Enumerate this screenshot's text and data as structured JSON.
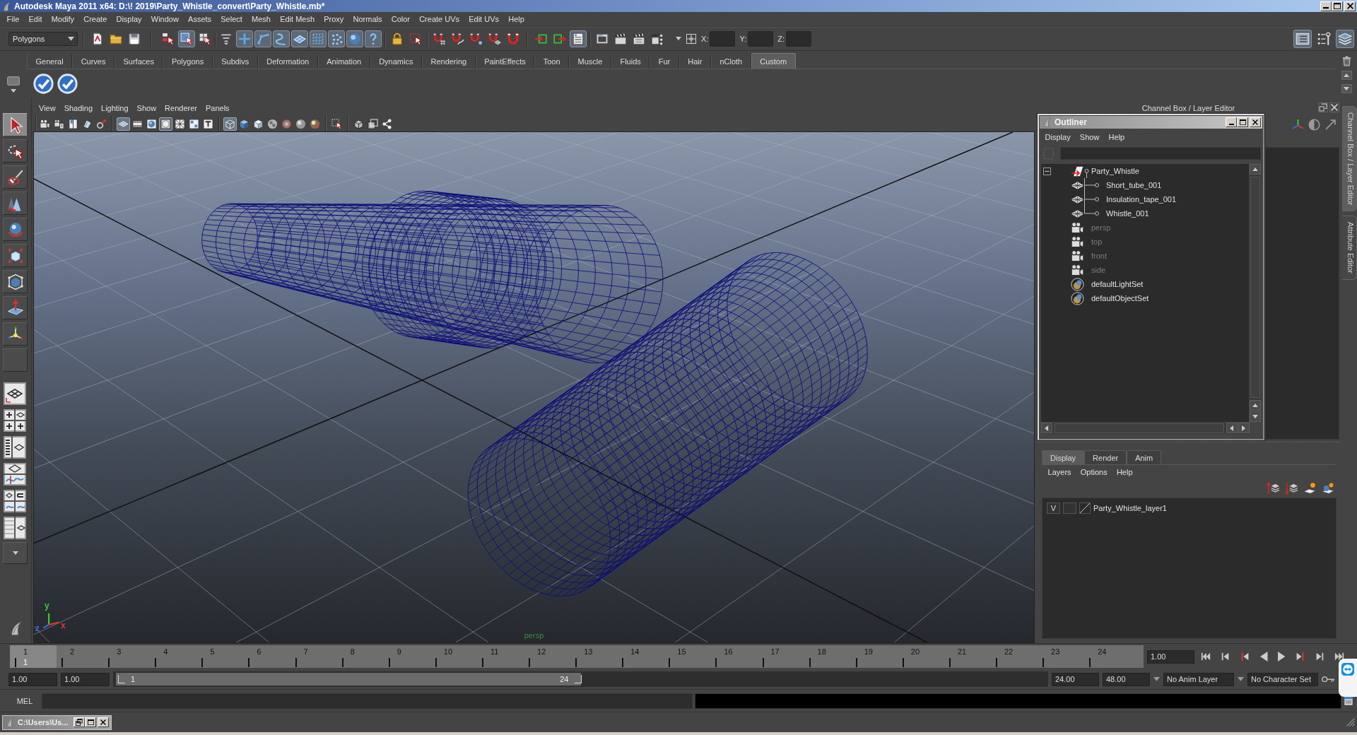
{
  "window": {
    "title": "Autodesk Maya 2011 x64: D:\\! 2019\\Party_Whistle_convert\\Party_Whistle.mb*"
  },
  "menu_bar": [
    "File",
    "Edit",
    "Modify",
    "Create",
    "Display",
    "Window",
    "Assets",
    "Select",
    "Mesh",
    "Edit Mesh",
    "Proxy",
    "Normals",
    "Color",
    "Create UVs",
    "Edit UVs",
    "Help"
  ],
  "status_line": {
    "menu_set": "Polygons",
    "buttons": [
      {
        "on": false
      },
      {
        "on": false
      },
      {
        "on": false
      },
      {
        "on": false
      },
      {
        "on": true
      },
      {
        "on": false
      },
      {
        "on": false
      },
      {
        "on": true
      },
      {
        "on": true
      },
      {
        "on": true
      },
      {
        "on": true
      },
      {
        "on": true
      },
      {
        "on": true
      },
      {
        "on": true
      },
      {
        "on": true
      },
      {
        "on": false
      },
      {
        "on": false
      },
      {
        "on": false
      },
      {
        "on": false
      },
      {
        "on": false
      },
      {
        "on": false
      },
      {
        "on": false
      },
      {
        "on": false
      },
      {
        "on": false
      },
      {
        "on": true
      },
      {
        "on": false
      },
      {
        "on": false
      },
      {
        "on": false
      },
      {
        "on": false
      }
    ],
    "coordinate_fields": [
      {
        "label": "X:"
      },
      {
        "label": "Y:"
      },
      {
        "label": "Z:"
      }
    ],
    "panel_toggles": [
      {
        "on": true
      },
      {
        "on": false
      },
      {
        "on": true
      }
    ]
  },
  "shelf": {
    "tabs": [
      {
        "label": "General",
        "selected": false
      },
      {
        "label": "Curves",
        "selected": false
      },
      {
        "label": "Surfaces",
        "selected": false
      },
      {
        "label": "Polygons",
        "selected": false
      },
      {
        "label": "Subdivs",
        "selected": false
      },
      {
        "label": "Deformation",
        "selected": false
      },
      {
        "label": "Animation",
        "selected": false
      },
      {
        "label": "Dynamics",
        "selected": false
      },
      {
        "label": "Rendering",
        "selected": false
      },
      {
        "label": "PaintEffects",
        "selected": false
      },
      {
        "label": "Toon",
        "selected": false
      },
      {
        "label": "Muscle",
        "selected": false
      },
      {
        "label": "Fluids",
        "selected": false
      },
      {
        "label": "Fur",
        "selected": false
      },
      {
        "label": "Hair",
        "selected": false
      },
      {
        "label": "nCloth",
        "selected": false
      },
      {
        "label": "Custom",
        "selected": true
      }
    ]
  },
  "toolbox": {
    "tools": [
      {
        "selected": true
      },
      {
        "selected": false
      },
      {
        "selected": false
      },
      {
        "selected": false
      },
      {
        "selected": false
      },
      {
        "selected": false
      },
      {
        "selected": false
      },
      {
        "selected": false
      },
      {
        "selected": false
      },
      {
        "selected": false
      }
    ]
  },
  "viewport": {
    "menu": [
      "View",
      "Shading",
      "Lighting",
      "Show",
      "Renderer",
      "Panels"
    ],
    "buttons": [
      {
        "on": false
      },
      {
        "on": false
      },
      {
        "on": false
      },
      {
        "on": false
      },
      {
        "on": false
      },
      {
        "on": true
      },
      {
        "on": false
      },
      {
        "on": false
      },
      {
        "on": true
      },
      {
        "on": false
      },
      {
        "on": false
      },
      {
        "on": false
      },
      {
        "on": true
      },
      {
        "on": false
      },
      {
        "on": false
      },
      {
        "on": false
      },
      {
        "on": false
      },
      {
        "on": false
      },
      {
        "on": false
      },
      {
        "on": false
      },
      {
        "on": false
      },
      {
        "on": false
      },
      {
        "on": false
      }
    ],
    "camera": "persp",
    "axes": [
      {
        "label": "y",
        "color": "#3cc83c"
      },
      {
        "label": "z",
        "color": "#3a6ee8"
      },
      {
        "label": "x",
        "color": "#e03838"
      }
    ]
  },
  "channel_box": {
    "title": "Channel Box / Layer Editor"
  },
  "outliner": {
    "title": "Outliner",
    "menu": [
      "Display",
      "Show",
      "Help"
    ],
    "items": [
      {
        "label": "Party_Whistle",
        "kind": "group",
        "expanded": true,
        "dimmed": false,
        "children": [
          {
            "label": "Short_tube_001",
            "kind": "mesh",
            "dimmed": false
          },
          {
            "label": "Insulation_tape_001",
            "kind": "mesh",
            "dimmed": false
          },
          {
            "label": "Whistle_001",
            "kind": "mesh",
            "dimmed": false
          }
        ]
      },
      {
        "label": "persp",
        "kind": "camera",
        "dimmed": true
      },
      {
        "label": "top",
        "kind": "camera",
        "dimmed": true
      },
      {
        "label": "front",
        "kind": "camera",
        "dimmed": true
      },
      {
        "label": "side",
        "kind": "camera",
        "dimmed": true
      },
      {
        "label": "defaultLightSet",
        "kind": "set",
        "dimmed": false
      },
      {
        "label": "defaultObjectSet",
        "kind": "set",
        "dimmed": false
      }
    ]
  },
  "side_tabs": [
    {
      "label": "Channel Box / Layer Editor",
      "selected": true
    },
    {
      "label": "Attribute Editor",
      "selected": false
    }
  ],
  "layer_editor": {
    "tabs": [
      {
        "label": "Display",
        "selected": true
      },
      {
        "label": "Render",
        "selected": false
      },
      {
        "label": "Anim",
        "selected": false
      }
    ],
    "menu": [
      "Layers",
      "Options",
      "Help"
    ],
    "layers": [
      {
        "visibility": "V",
        "name": "Party_Whistle_layer1"
      }
    ]
  },
  "time_slider": {
    "frames": [
      {
        "label": "1",
        "selected": true
      },
      {
        "label": "2",
        "selected": false
      },
      {
        "label": "3",
        "selected": false
      },
      {
        "label": "4",
        "selected": false
      },
      {
        "label": "5",
        "selected": false
      },
      {
        "label": "6",
        "selected": false
      },
      {
        "label": "7",
        "selected": false
      },
      {
        "label": "8",
        "selected": false
      },
      {
        "label": "9",
        "selected": false
      },
      {
        "label": "10",
        "selected": false
      },
      {
        "label": "11",
        "selected": false
      },
      {
        "label": "12",
        "selected": false
      },
      {
        "label": "13",
        "selected": false
      },
      {
        "label": "14",
        "selected": false
      },
      {
        "label": "15",
        "selected": false
      },
      {
        "label": "16",
        "selected": false
      },
      {
        "label": "17",
        "selected": false
      },
      {
        "label": "18",
        "selected": false
      },
      {
        "label": "19",
        "selected": false
      },
      {
        "label": "20",
        "selected": false
      },
      {
        "label": "21",
        "selected": false
      },
      {
        "label": "22",
        "selected": false
      },
      {
        "label": "23",
        "selected": false
      },
      {
        "label": "24",
        "selected": false
      }
    ],
    "current_frame": "1",
    "current_time": "1.00"
  },
  "range_slider": {
    "start_time": "1.00",
    "playback_start": "1.00",
    "range_start": "1",
    "range_end": "24",
    "level": 0.5,
    "playback_end": "24.00",
    "end_time": "48.00",
    "anim_layer": "No Anim Layer",
    "character_set": "No Character Set"
  },
  "command_line": {
    "language": "MEL"
  },
  "taskbar": {
    "windows": [
      {
        "title": "C:\\Users\\Us..."
      }
    ]
  }
}
